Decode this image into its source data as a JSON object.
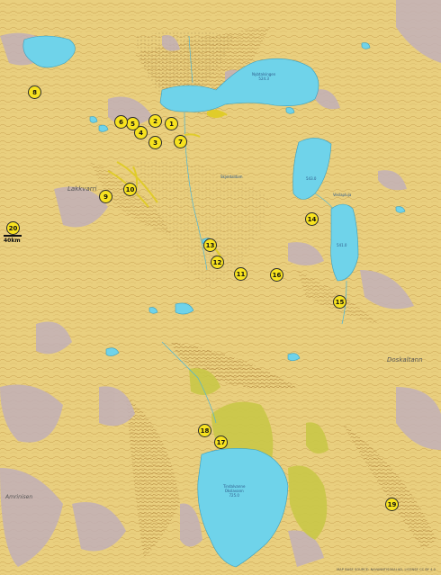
{
  "map": {
    "colors": {
      "land": "#e9cf7e",
      "water": "#6fd3ea",
      "rock": "#c2b0b8",
      "marsh": "#c9c847",
      "contour": "#b5852f",
      "marker": "#f7e21f"
    },
    "markers": [
      "1",
      "2",
      "3",
      "4",
      "5",
      "6",
      "7",
      "8",
      "9",
      "10",
      "11",
      "12",
      "13",
      "14",
      "15",
      "16",
      "17",
      "18",
      "19",
      "20"
    ],
    "scale_label": "40km",
    "place_names": [
      "Lakkvarri",
      "Doskaltann",
      "Amrinisen"
    ],
    "lake_labels": [
      "Nybtalsingen\n524.3",
      "Skjeldaldam",
      "543.0",
      "Veslapluja",
      "541.0",
      "Tindalvanne\nOkslavann\n725.0"
    ],
    "source_text": "MAP BASE SOURCE: NAVANNTISSKALAD, LICENSE CC BY 4.0"
  }
}
